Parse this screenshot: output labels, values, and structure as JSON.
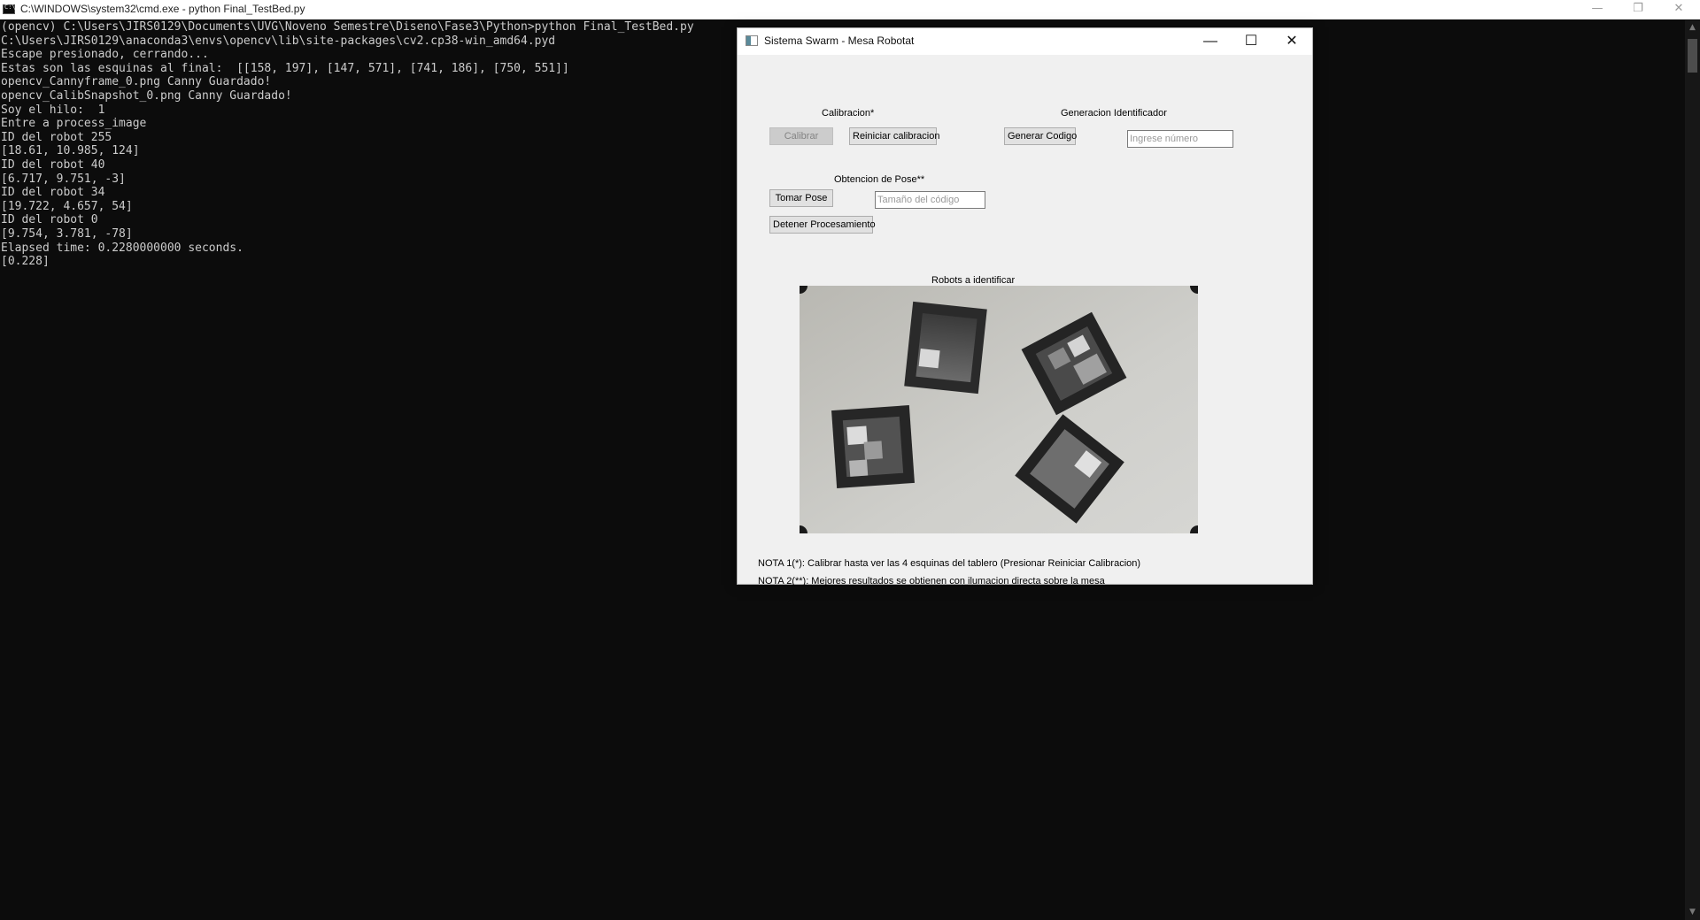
{
  "cmd": {
    "title": "C:\\WINDOWS\\system32\\cmd.exe - python  Final_TestBed.py",
    "minimize": "—",
    "restore": "❐",
    "close": "✕",
    "lines": [
      "(opencv) C:\\Users\\JIRS0129\\Documents\\UVG\\Noveno Semestre\\Diseno\\Fase3\\Python>python Final_TestBed.py",
      "C:\\Users\\JIRS0129\\anaconda3\\envs\\opencv\\lib\\site-packages\\cv2.cp38-win_amd64.pyd",
      "Escape presionado, cerrando...",
      "Estas son las esquinas al final:  [[158, 197], [147, 571], [741, 186], [750, 551]]",
      "opencv_Cannyframe_0.png Canny Guardado!",
      "opencv_CalibSnapshot_0.png Canny Guardado!",
      "Soy el hilo:  1",
      "Entre a process_image",
      "ID del robot 255",
      "[18.61, 10.985, 124]",
      "ID del robot 40",
      "[6.717, 9.751, -3]",
      "ID del robot 34",
      "[19.722, 4.657, 54]",
      "ID del robot 0",
      "[9.754, 3.781, -78]",
      "Elapsed time: 0.2280000000 seconds.",
      "[0.228]"
    ]
  },
  "app": {
    "title": "Sistema Swarm - Mesa Robotat",
    "minimize": "—",
    "maximize": "☐",
    "close": "✕",
    "calibration": {
      "heading": "Calibracion*",
      "calibrate_label": "Calibrar",
      "reset_label": "Reiniciar calibracion"
    },
    "identifier": {
      "heading": "Generacion Identificador",
      "generate_label": "Generar Codigo",
      "number_placeholder": "Ingrese número"
    },
    "pose": {
      "heading": "Obtencion de Pose**",
      "take_pose_label": "Tomar Pose",
      "size_placeholder": "Tamaño del código",
      "stop_label": "Detener Procesamiento"
    },
    "camera": {
      "heading": "Robots a identificar"
    },
    "notes": {
      "note1": "NOTA 1(*): Calibrar hasta ver las 4 esquinas del tablero (Presionar Reiniciar Calibracion)",
      "note2": "NOTA 2(**): Mejores resultados se obtienen con ilumacion directa sobre la mesa"
    }
  }
}
